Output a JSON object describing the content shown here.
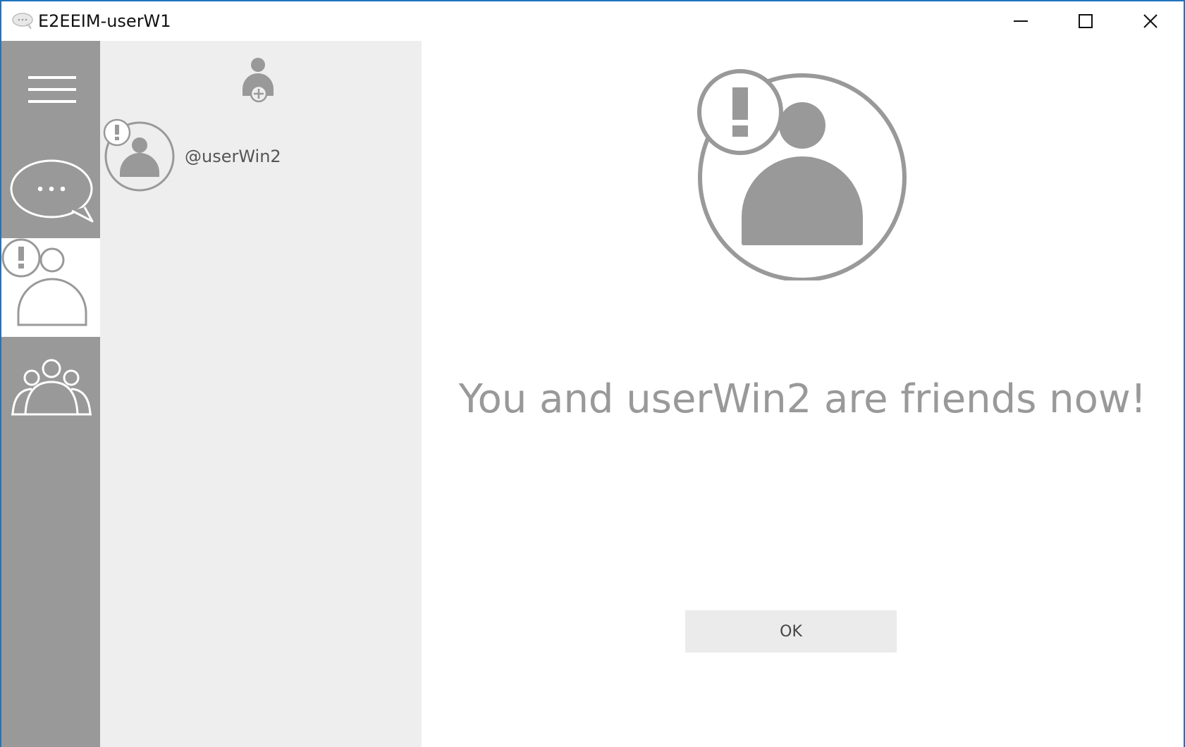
{
  "window": {
    "title": "E2EEIM-userW1",
    "app_icon": "chat-bubble-icon",
    "controls": [
      "minimize-icon",
      "maximize-icon",
      "close-icon"
    ]
  },
  "rail": {
    "items": [
      {
        "name": "menu",
        "icon": "hamburger-menu-icon",
        "selected": false
      },
      {
        "name": "chats",
        "icon": "chat-bubble-icon",
        "selected": false
      },
      {
        "name": "friend-requests",
        "icon": "user-alert-icon",
        "selected": true
      },
      {
        "name": "groups",
        "icon": "group-icon",
        "selected": false
      }
    ]
  },
  "list": {
    "add_button_icon": "add-user-icon",
    "contacts": [
      {
        "name": "@userWin2",
        "icon": "user-alert-icon"
      }
    ]
  },
  "main": {
    "icon": "user-alert-icon",
    "message": "You and userWin2 are friends now!",
    "ok_label": "OK"
  },
  "colors": {
    "rail": "#999999",
    "panel": "#eeeeee",
    "icon": "#999999",
    "accent_border": "#1f74bf",
    "button_bg": "#ebebeb"
  }
}
